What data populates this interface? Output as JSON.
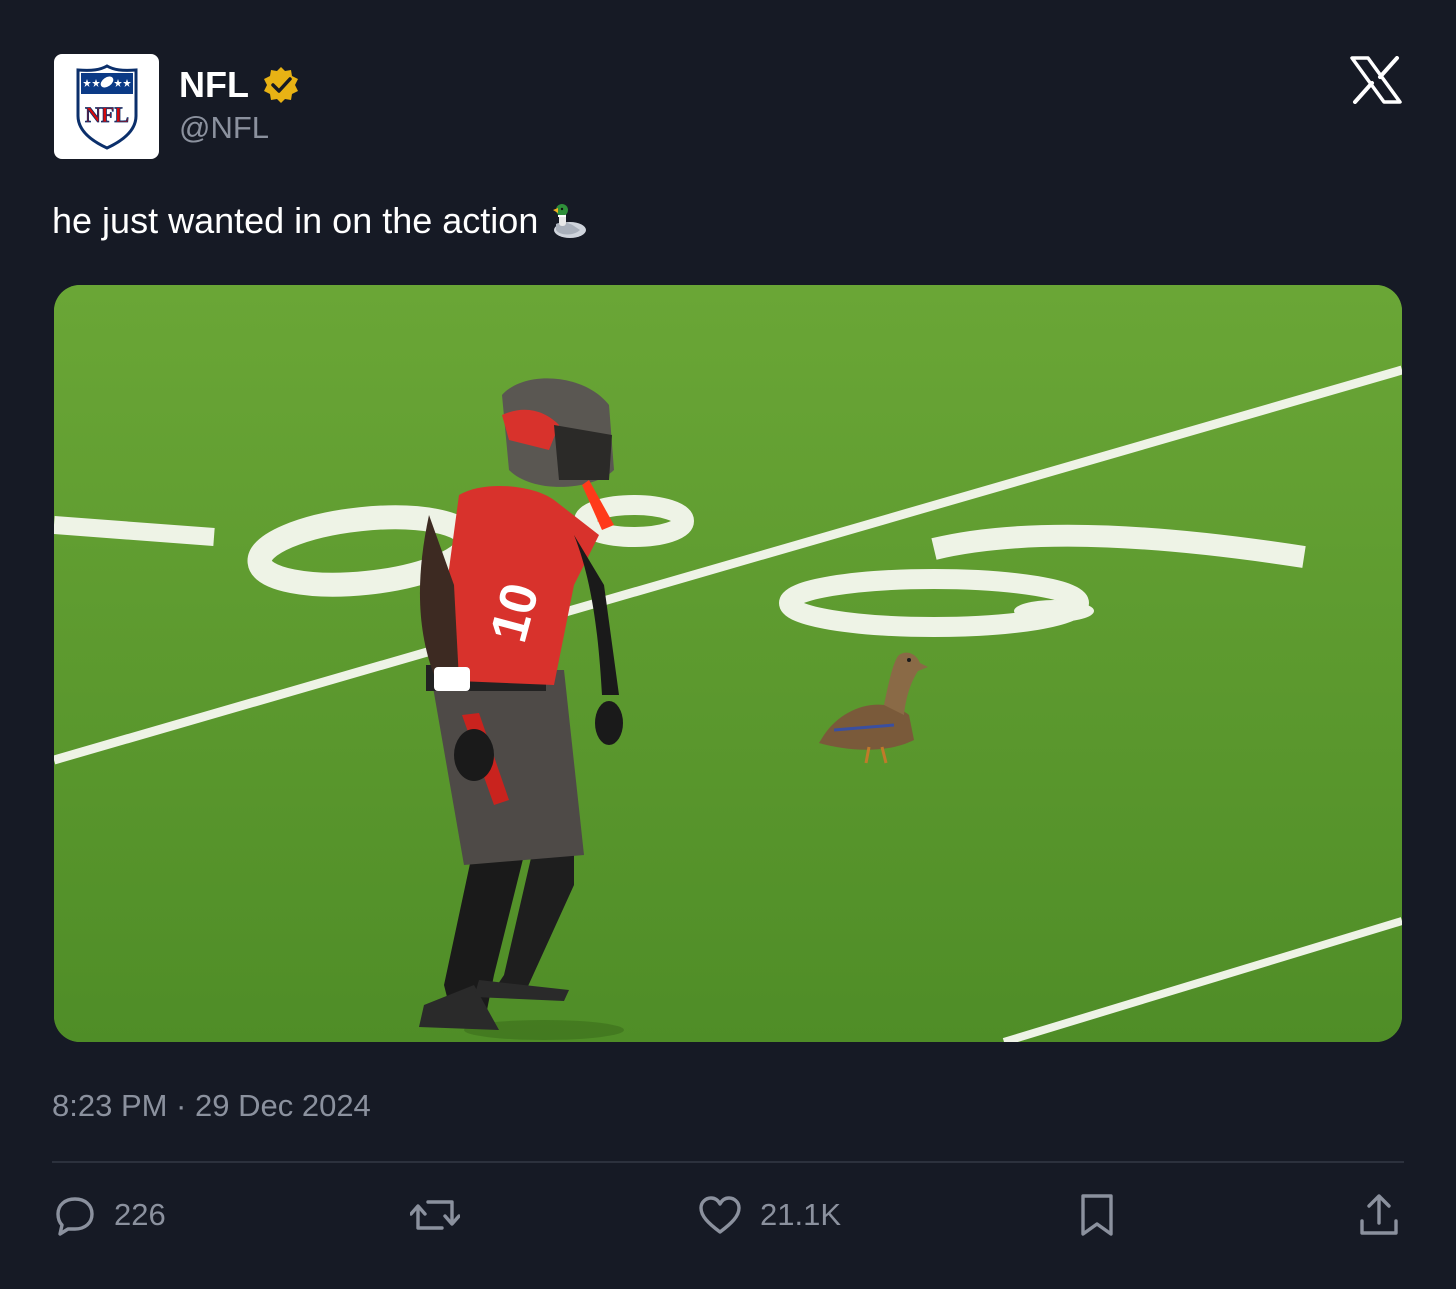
{
  "account": {
    "display_name": "NFL",
    "handle": "@NFL",
    "avatar_logo_text": "NFL",
    "verified": true,
    "verified_badge_color": "#e8b214"
  },
  "tweet": {
    "text": "he just wanted in on the action",
    "emoji": "duck-emoji",
    "media_description": "photo",
    "timestamp": "8:23 PM · 29 Dec 2024"
  },
  "actions": {
    "replies": "226",
    "reposts": "",
    "likes": "21.1K"
  },
  "icons": [
    "x-logo-icon",
    "verified-badge-icon",
    "reply-icon",
    "repost-icon",
    "like-icon",
    "bookmark-icon",
    "share-icon"
  ],
  "colors": {
    "background": "#161a25",
    "text_primary": "#ffffff",
    "text_secondary": "#8b919e",
    "divider": "#2c313d"
  }
}
